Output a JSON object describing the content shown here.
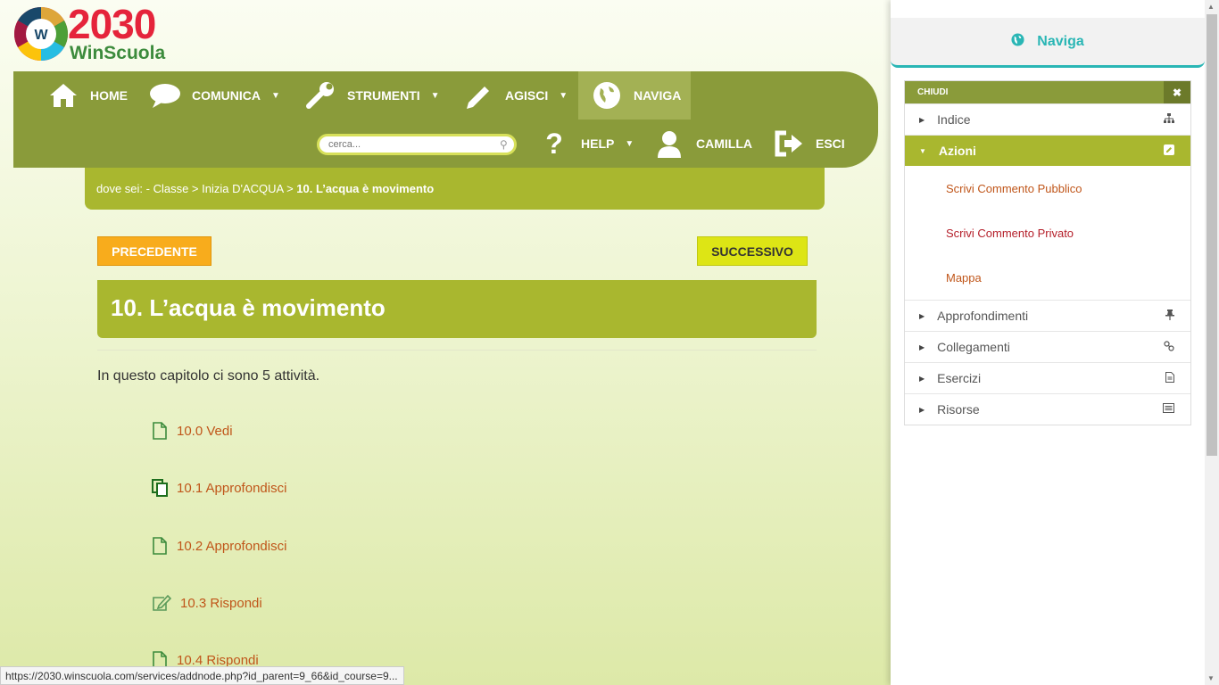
{
  "logo": {
    "year": "2030",
    "name": "WinScuola",
    "wheel_letter": "W"
  },
  "nav": {
    "home": "HOME",
    "comunica": "COMUNICA",
    "strumenti": "STRUMENTI",
    "agisci": "AGISCI",
    "naviga": "NAVIGA",
    "help": "HELP",
    "user": "CAMILLA",
    "esci": "ESCI",
    "search_placeholder": "cerca..."
  },
  "breadcrumb": {
    "prefix": "dove sei: - Classe > Inizia D'ACQUA > ",
    "current": "10. L’acqua è movimento"
  },
  "buttons": {
    "prev": "PRECEDENTE",
    "next": "SUCCESSIVO"
  },
  "chapter": {
    "title": "10. L’acqua è movimento",
    "intro": "In questo capitolo ci sono 5 attività.",
    "activities": [
      {
        "label": "10.0 Vedi",
        "icon": "document-icon"
      },
      {
        "label": "10.1 Approfondisci",
        "icon": "copy-icon"
      },
      {
        "label": "10.2 Approfondisci",
        "icon": "document-icon"
      },
      {
        "label": "10.3 Rispondi",
        "icon": "edit-icon"
      },
      {
        "label": "10.4 Rispondi",
        "icon": "document-icon"
      }
    ]
  },
  "status_url": "https://2030.winscuola.com/services/addnode.php?id_parent=9_66&id_course=9...",
  "panel": {
    "title": "Naviga",
    "close_label": "CHIUDI",
    "items": {
      "indice": "Indice",
      "azioni": "Azioni",
      "approfondimenti": "Approfondimenti",
      "collegamenti": "Collegamenti",
      "esercizi": "Esercizi",
      "risorse": "Risorse"
    },
    "azioni_sub": {
      "pubblico": "Scrivi Commento Pubblico",
      "privato": "Scrivi Commento Privato",
      "mappa": "Mappa"
    }
  },
  "colors": {
    "nav": "#8a9b3a",
    "accent": "#a9b72f",
    "teal": "#2ab6b5",
    "prev": "#f8ac1c",
    "next": "#dde515",
    "link": "#c0561a",
    "private_link": "#b5202b"
  }
}
